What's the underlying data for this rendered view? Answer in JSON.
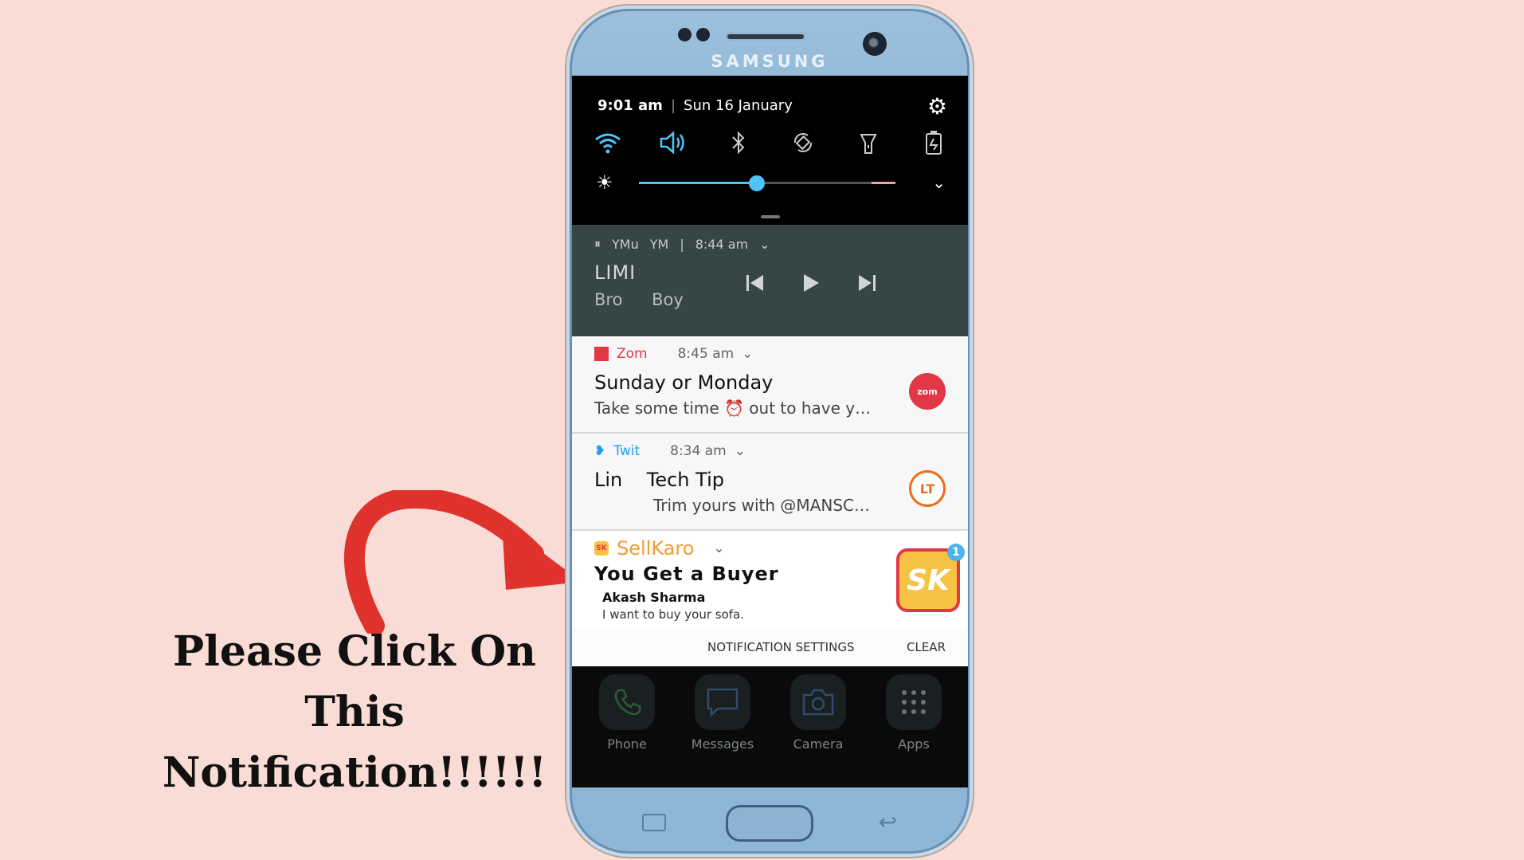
{
  "caption": {
    "line1": "Please Click On This",
    "line2": "Notification!!!!!!"
  },
  "phone": {
    "brand": "SAMSUNG"
  },
  "status": {
    "time": "9:01 am",
    "date": "Sun 16 January"
  },
  "quick_settings": {
    "icons": [
      "wifi-icon",
      "sound-icon",
      "bluetooth-icon",
      "auto-rotate-icon",
      "flashlight-icon",
      "power-saving-icon"
    ],
    "accent": "#4fc3f7",
    "brightness": 0.46
  },
  "music": {
    "app1": "YMu",
    "app2": "YM",
    "time": "8:44 am",
    "title": "LIMI",
    "artist": "Bro Boy"
  },
  "notifications": [
    {
      "app": "Zom",
      "time": "8:45 am",
      "title": "Sunday or Monday",
      "text": "Take some time ⏰ out to have y…",
      "icon_label": "zom",
      "color": "#e23744"
    },
    {
      "app": "Twit",
      "time": "8:34 am",
      "title": "Lin    Tech Tip",
      "text": "Trim yours with @MANSC…",
      "icon_label": "LT",
      "color": "#ef6c1a"
    },
    {
      "app": "SellKaro",
      "title": "You Get a Buyer",
      "sender": "Akash Sharma",
      "text": "I want to buy your sofa.",
      "icon_label": "SK",
      "badge": "1",
      "color": "#f29c38"
    }
  ],
  "actions": {
    "settings": "NOTIFICATION SETTINGS",
    "clear": "CLEAR"
  },
  "dock": [
    {
      "label": "Phone"
    },
    {
      "label": "Messages"
    },
    {
      "label": "Camera"
    },
    {
      "label": "Apps"
    }
  ]
}
